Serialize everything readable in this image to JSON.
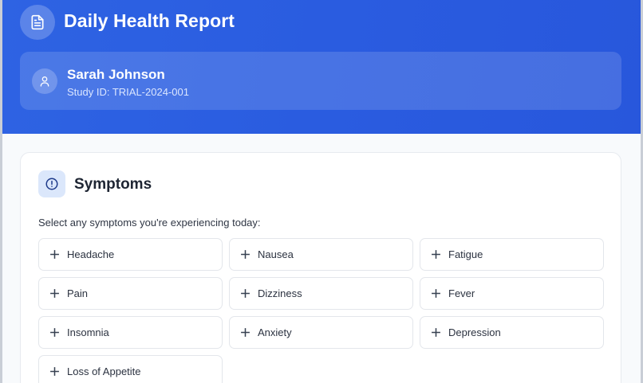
{
  "header": {
    "title": "Daily Health Report",
    "icon": "document-icon",
    "accent": "#2a5ce0"
  },
  "patient": {
    "name": "Sarah Johnson",
    "study_id": "Study ID: TRIAL-2024-001",
    "icon": "user-icon"
  },
  "symptoms_section": {
    "title": "Symptoms",
    "icon": "alert-circle-icon",
    "prompt": "Select any symptoms you're experiencing today:",
    "options": [
      {
        "label": "Headache"
      },
      {
        "label": "Nausea"
      },
      {
        "label": "Fatigue"
      },
      {
        "label": "Pain"
      },
      {
        "label": "Dizziness"
      },
      {
        "label": "Fever"
      },
      {
        "label": "Insomnia"
      },
      {
        "label": "Anxiety"
      },
      {
        "label": "Depression"
      },
      {
        "label": "Loss of Appetite"
      }
    ]
  }
}
